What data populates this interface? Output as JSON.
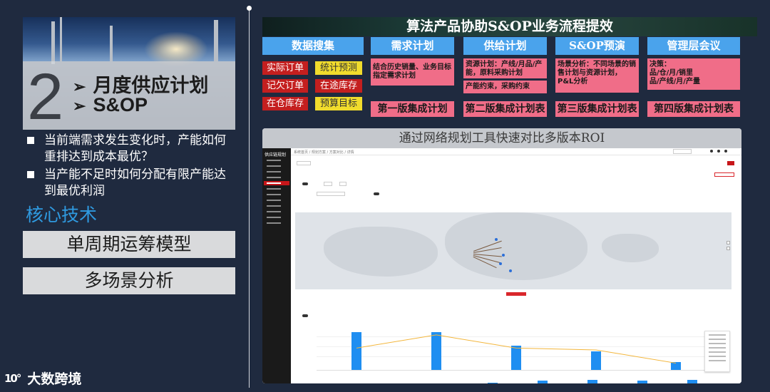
{
  "left": {
    "hero": {
      "number": "2",
      "arrow": "➢",
      "line1": "月度供应计划",
      "line2": "S&OP"
    },
    "bullets": [
      "当前端需求发生变化时，产能如何重排达到成本最优？",
      "当产能不足时如何分配有限产能达到最优利润"
    ],
    "core_tech_title": "核心技术",
    "core_tech_items": [
      "单周期运筹模型",
      "多场景分析"
    ],
    "logo": {
      "mark": "10°",
      "text": "大数跨境"
    }
  },
  "flow": {
    "banner": "算法产品协助S&OP业务流程提效",
    "columns": [
      "数据搜集",
      "需求计划",
      "供给计划",
      "S&OP预演",
      "管理层会议"
    ],
    "data_chips": [
      {
        "label": "实际订单",
        "color": "red"
      },
      {
        "label": "统计预测",
        "color": "yellow"
      },
      {
        "label": "记欠订单",
        "color": "red"
      },
      {
        "label": "在途库存",
        "color": "red"
      },
      {
        "label": "在仓库存",
        "color": "red"
      },
      {
        "label": "预算目标",
        "color": "yellow"
      }
    ],
    "demand_note": "结合历史销量、业务目标指定需求计划",
    "supply_note1": "资源计划：产线/月品/产能，原料采购计划",
    "supply_note2": "产能约束，采购约束",
    "sop_note": "场景分析：不同场景的销售计划与资源计划，P&L分析",
    "mgmt_note": "决策：\n品/仓/月/销里\n品/产线/月/产量",
    "versions": [
      "第一版集成计划",
      "第二版集成计划表",
      "第三版集成计划表",
      "第四版集成计划表"
    ]
  },
  "roi": {
    "title": "通过网络规划工具快速对比多版本ROI",
    "app": {
      "brand": "供应链规划",
      "breadcrumb": "系统首页 / 规划方案 / 方案对比 / 详情"
    }
  },
  "colors": {
    "page_bg": "#1f2a3f",
    "accent_blue": "#4aa3ec",
    "chip_red": "#c41f1f",
    "chip_yellow": "#f1dc2c",
    "pink": "#f06d88",
    "core_title": "#2f9ae0"
  },
  "chart_data": {
    "type": "bar",
    "series": [
      {
        "values": [
          100,
          100,
          65,
          50,
          20
        ]
      }
    ],
    "line": [
      60,
      95,
      60,
      55,
      20
    ]
  }
}
